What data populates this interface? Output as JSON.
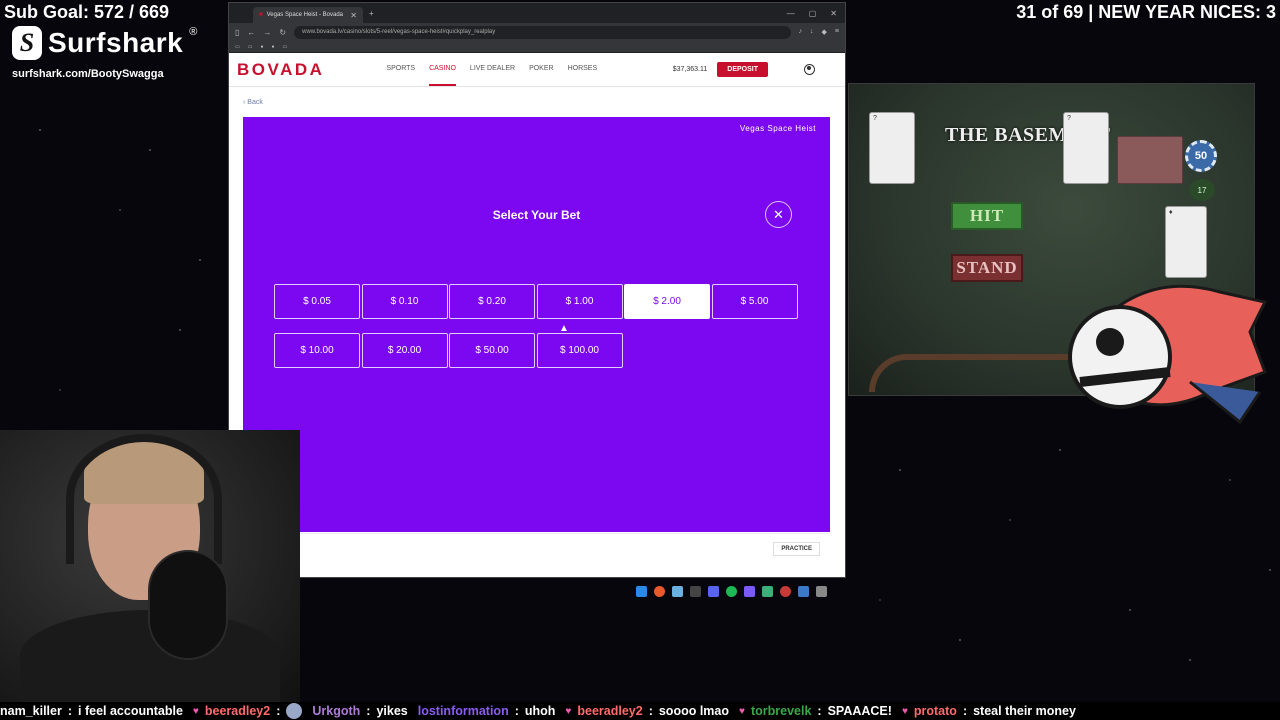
{
  "overlay": {
    "sub_goal": "Sub Goal: 572 / 669",
    "sponsor": "Surfshark",
    "sponsor_reg": "®",
    "sponsor_url": "surfshark.com/BootySwagga",
    "counter": "31 of 69 | NEW YEAR NICES: 3"
  },
  "browser": {
    "tab_title": "Vegas Space Heist - Bovada",
    "url": "www.bovada.lv/casino/slots/5-reel/vegas-space-heist#quickplay_realplay"
  },
  "site": {
    "logo": "BOVADA",
    "nav": [
      "SPORTS",
      "CASINO",
      "LIVE DEALER",
      "POKER",
      "HORSES"
    ],
    "active_nav": "CASINO",
    "balance": "$37,363.11",
    "deposit": "DEPOSIT",
    "back": "Back"
  },
  "game": {
    "title": "Vegas Space Heist",
    "modal_title": "Select Your Bet",
    "bets": [
      "$ 0.05",
      "$ 0.10",
      "$ 0.20",
      "$ 1.00",
      "$ 2.00",
      "$ 5.00",
      "$ 10.00",
      "$ 20.00",
      "$ 50.00",
      "$ 100.00"
    ],
    "selected_bet": "$ 2.00",
    "practice": "PRACTICE"
  },
  "scene": {
    "title": "THE BASEMENT",
    "hit": "HIT",
    "stand": "STAND",
    "chip": "50",
    "score": "17"
  },
  "chat": [
    {
      "user": "nam_killer",
      "color": "#ffffff",
      "msg": "i feel accountable"
    },
    {
      "user": "beeradley2",
      "color": "#ff6a6a",
      "msg": ""
    },
    {
      "user": "Urkgoth",
      "color": "#b07ad8",
      "msg": "yikes"
    },
    {
      "user": "lostinformation",
      "color": "#8a5cf0",
      "msg": "uhoh"
    },
    {
      "user": "beeradley2",
      "color": "#ff6a6a",
      "msg": "soooo lmao"
    },
    {
      "user": "torbrevelk",
      "color": "#3aa84a",
      "msg": "SPAAACE!"
    },
    {
      "user": "protato",
      "color": "#ff6a6a",
      "msg": "steal their money"
    }
  ],
  "colors": {
    "game_bg": "#7b08f0",
    "brand_red": "#c8102e"
  }
}
